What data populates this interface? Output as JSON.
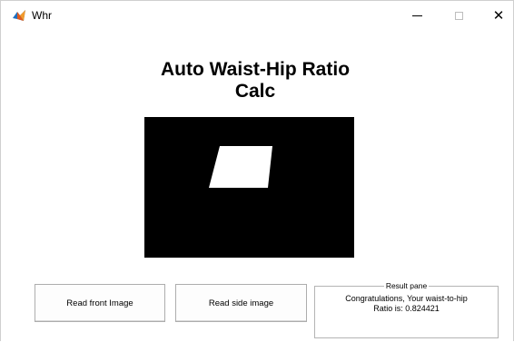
{
  "window": {
    "title": "Whr",
    "controls": {
      "minimize": "minimize-icon",
      "maximize": "maximize-icon",
      "close_glyph": "✕"
    }
  },
  "main": {
    "heading_line1": "Auto Waist-Hip Ratio",
    "heading_line2": "Calc",
    "image_display": {
      "background": "#000000",
      "shape_fill": "#ffffff"
    }
  },
  "buttons": {
    "front_label": "Read front Image",
    "side_label": "Read side image"
  },
  "result": {
    "pane_title": "Result pane",
    "line1": "Congratulations, Your waist-to-hip",
    "line2": "Ratio is: 0.824421"
  }
}
